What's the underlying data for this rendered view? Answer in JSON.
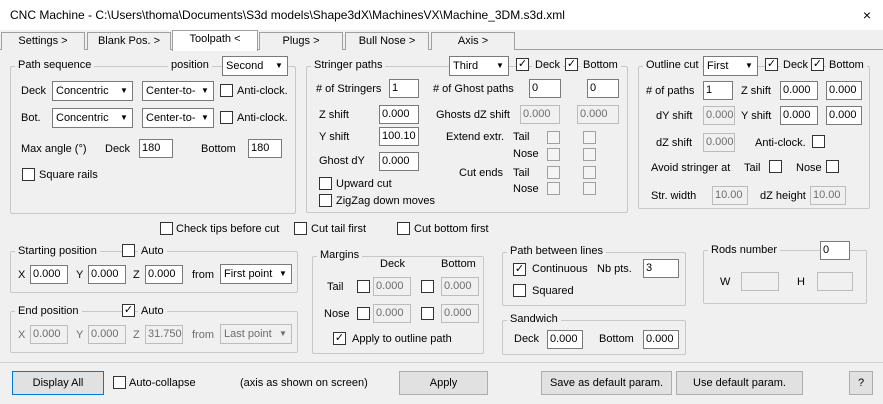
{
  "window": {
    "title": "CNC Machine - C:\\Users\\thoma\\Documents\\S3d models\\Shape3dX\\MachinesVX\\Machine_3DM.s3d.xml",
    "close_label": "×"
  },
  "tabs": [
    "Settings >",
    "Blank Pos. >",
    "Toolpath <",
    "Plugs >",
    "Bull Nose >",
    "Axis >"
  ],
  "path_sequence": {
    "title": "Path sequence",
    "position_label": "position",
    "position_value": "Second",
    "deck_label": "Deck",
    "deck_pattern": "Concentric",
    "deck_start": "Center-to-",
    "deck_anticlock": "Anti-clock.",
    "bot_label": "Bot.",
    "bot_pattern": "Concentric",
    "bot_start": "Center-to-",
    "bot_anticlock": "Anti-clock.",
    "max_angle_label": "Max angle (°)",
    "max_angle_deck_label": "Deck",
    "max_angle_deck": "180",
    "max_angle_bottom_label": "Bottom",
    "max_angle_bottom": "180",
    "square_rails": "Square rails"
  },
  "stringer_paths": {
    "title": "Stringer paths",
    "mode": "Third",
    "deck_label": "Deck",
    "deck_checked": true,
    "bottom_label": "Bottom",
    "bottom_checked": true,
    "num_stringers_label": "# of Stringers",
    "num_stringers": "1",
    "num_ghost_label": "# of Ghost paths",
    "num_ghost_1": "0",
    "num_ghost_2": "0",
    "z_shift_label": "Z shift",
    "z_shift": "0.000",
    "ghosts_dz_label": "Ghosts dZ shift",
    "ghosts_dz_1": "0.000",
    "ghosts_dz_2": "0.000",
    "y_shift_label": "Y shift",
    "y_shift": "100.10",
    "extend_label": "Extend extr.",
    "tail_label": "Tail",
    "nose_label": "Nose",
    "ghost_dy_label": "Ghost dY",
    "ghost_dy": "0.000",
    "cut_ends_label": "Cut ends",
    "upward_cut": "Upward cut",
    "zigzag": "ZigZag down moves"
  },
  "outline_cut": {
    "title": "Outline cut",
    "mode": "First",
    "deck_label": "Deck",
    "deck_checked": true,
    "bottom_label": "Bottom",
    "bottom_checked": true,
    "num_paths_label": "# of paths",
    "num_paths": "1",
    "z_shift_label": "Z shift",
    "z_shift_1": "0.000",
    "z_shift_2": "0.000",
    "dy_shift_label": "dY shift",
    "dy_shift": "0.000",
    "y_shift_label": "Y shift",
    "y_shift_1": "0.000",
    "y_shift_2": "0.000",
    "dz_shift_label": "dZ shift",
    "dz_shift": "0.000",
    "anticlock": "Anti-clock.",
    "avoid_label": "Avoid stringer at",
    "tail_label": "Tail",
    "nose_label": "Nose",
    "str_width_label": "Str. width",
    "str_width": "10.00",
    "dz_height_label": "dZ height",
    "dz_height": "10.00"
  },
  "options": {
    "check_tips": "Check tips before cut",
    "cut_tail_first": "Cut tail first",
    "cut_bottom_first": "Cut bottom first"
  },
  "starting_position": {
    "title": "Starting position",
    "auto_label": "Auto",
    "auto_checked": false,
    "x_label": "X",
    "x": "0.000",
    "y_label": "Y",
    "y": "0.000",
    "z_label": "Z",
    "z": "0.000",
    "from_label": "from",
    "from_value": "First point"
  },
  "end_position": {
    "title": "End position",
    "auto_label": "Auto",
    "auto_checked": true,
    "x_label": "X",
    "x": "0.000",
    "y_label": "Y",
    "y": "0.000",
    "z_label": "Z",
    "z": "31.750",
    "from_label": "from",
    "from_value": "Last point"
  },
  "margins": {
    "title": "Margins",
    "deck_label": "Deck",
    "bottom_label": "Bottom",
    "tail_label": "Tail",
    "nose_label": "Nose",
    "tail_deck": "0.000",
    "tail_bottom": "0.000",
    "nose_deck": "0.000",
    "nose_bottom": "0.000",
    "apply_outline": "Apply to outline path",
    "apply_outline_checked": true
  },
  "path_between": {
    "title": "Path between lines",
    "continuous": "Continuous",
    "continuous_checked": true,
    "nb_pts_label": "Nb pts.",
    "nb_pts": "3",
    "squared": "Squared"
  },
  "sandwich": {
    "title": "Sandwich",
    "deck_label": "Deck",
    "deck": "0.000",
    "bottom_label": "Bottom",
    "bottom": "0.000"
  },
  "rods": {
    "title": "Rods number",
    "value": "0",
    "w_label": "W",
    "h_label": "H"
  },
  "footer": {
    "display_all": "Display All",
    "auto_collapse": "Auto-collapse",
    "axis_note": "(axis as shown on screen)",
    "apply": "Apply",
    "save_default": "Save as default param.",
    "use_default": "Use default param.",
    "help": "?"
  },
  "check_mark": "✓",
  "dropdown_arrow": "▼"
}
